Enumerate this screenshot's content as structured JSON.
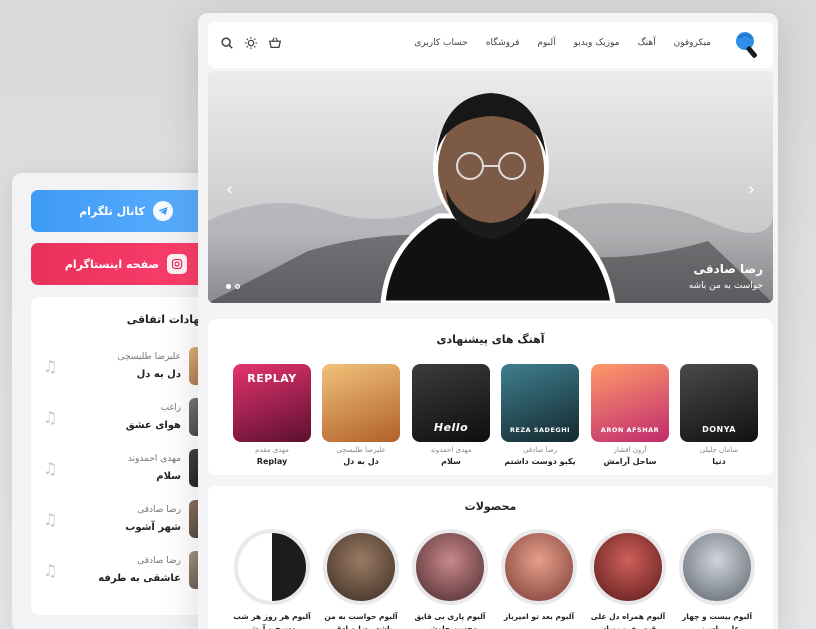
{
  "header": {
    "nav": [
      "میکروفون",
      "آهنگ",
      "موزیک ویدیو",
      "آلبوم",
      "فروشگاه",
      "حساب کاربری"
    ]
  },
  "hero": {
    "artist": "رضا صادقی",
    "subtitle": "حواست به من باشه"
  },
  "sidebar": {
    "telegram_label": "کانال تلگرام",
    "instagram_label": "صفحه اینستاگرام",
    "suggest_title": "پیشنهادات اتفاقی",
    "items": [
      {
        "artist": "علیرضا طلیسچی",
        "title": "دل به دل",
        "color": "#c9a07b"
      },
      {
        "artist": "راغب",
        "title": "هوای عشق",
        "color": "#4a4a4a"
      },
      {
        "artist": "مهدی احمدوند",
        "title": "سلام",
        "color": "#2a2a2a"
      },
      {
        "artist": "رضا صادقی",
        "title": "شهر آشوب",
        "color": "#6b5a4d"
      },
      {
        "artist": "رضا صادقی",
        "title": "عاشقی به طرفه",
        "color": "#7a6d60"
      }
    ]
  },
  "recommended": {
    "title": "آهنگ های پیشنهادی",
    "cards": [
      {
        "artist": "مهدی مقدم",
        "title": "Replay",
        "cover_text": "REPLAY",
        "color": "#c8256a"
      },
      {
        "artist": "علیرضا طلیسچی",
        "title": "دل به دل",
        "cover_text": "",
        "color": "#d9a35a"
      },
      {
        "artist": "مهدی احمدوند",
        "title": "سلام",
        "cover_text": "Hello",
        "color": "#1d1d1d"
      },
      {
        "artist": "رضا صادقی",
        "title": "یکبو دوست داشتم",
        "cover_text": "REZA SADEGHI",
        "color": "#3a6a7a"
      },
      {
        "artist": "آرون افشار",
        "title": "ساحل آرامش",
        "cover_text": "ARON AFSHAR",
        "color": "#e65d6a"
      },
      {
        "artist": "سامان جلیلی",
        "title": "دنیا",
        "cover_text": "DONYA",
        "color": "#2b2b2b"
      }
    ]
  },
  "products": {
    "title": "محصولات",
    "cards": [
      {
        "title": "آلبوم هر روز هر شب مسیح و آرش",
        "color": "#222"
      },
      {
        "title": "آلبوم حواست به من باشه رضا صادقی",
        "color": "#6b5748"
      },
      {
        "title": "آلبوم پاری بی قایق محسن چاوشی",
        "color": "#8a5a5e"
      },
      {
        "title": "آلبوم بعد تو امیرباز",
        "color": "#b8675f"
      },
      {
        "title": "آلبوم همراه دل علی قیصری و پویان کاظمیان",
        "color": "#9b3b3b"
      },
      {
        "title": "آلبوم بیست و چهار علی یاسینی",
        "color": "#9aa3ab"
      }
    ]
  }
}
